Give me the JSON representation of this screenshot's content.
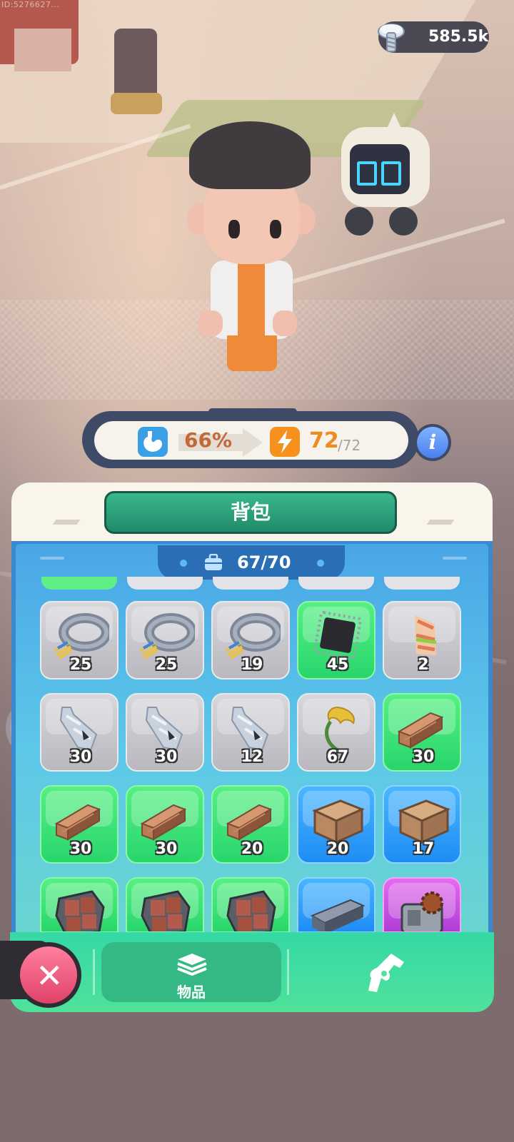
{
  "hud": {
    "currency": {
      "icon": "bolt-icon",
      "value": "585.5k"
    },
    "watermark": "ID:5276627..."
  },
  "stats": {
    "hunger": {
      "icon": "stomach-icon",
      "value": "66%"
    },
    "energy": {
      "icon": "lightning-icon",
      "current": "72",
      "max": "/72"
    },
    "info_label": "i"
  },
  "backpack": {
    "title": "背包",
    "capacity": "67/70",
    "items": [
      {
        "name": "cable",
        "quantity": "25",
        "rarity": "gray"
      },
      {
        "name": "cable",
        "quantity": "25",
        "rarity": "gray"
      },
      {
        "name": "cable",
        "quantity": "19",
        "rarity": "gray"
      },
      {
        "name": "chip",
        "quantity": "45",
        "rarity": "green"
      },
      {
        "name": "cloth-roll",
        "quantity": "2",
        "rarity": "gray"
      },
      {
        "name": "plastic-bottle",
        "quantity": "30",
        "rarity": "gray"
      },
      {
        "name": "plastic-bottle",
        "quantity": "30",
        "rarity": "gray"
      },
      {
        "name": "plastic-bottle",
        "quantity": "12",
        "rarity": "gray"
      },
      {
        "name": "dried-plant",
        "quantity": "67",
        "rarity": "gray"
      },
      {
        "name": "wood-planks",
        "quantity": "30",
        "rarity": "green"
      },
      {
        "name": "wood-planks",
        "quantity": "30",
        "rarity": "green"
      },
      {
        "name": "wood-planks",
        "quantity": "30",
        "rarity": "green"
      },
      {
        "name": "wood-planks",
        "quantity": "20",
        "rarity": "green"
      },
      {
        "name": "wooden-crate",
        "quantity": "20",
        "rarity": "blue"
      },
      {
        "name": "wooden-crate",
        "quantity": "17",
        "rarity": "blue"
      },
      {
        "name": "metal-plate",
        "quantity": "",
        "rarity": "green"
      },
      {
        "name": "metal-plate",
        "quantity": "",
        "rarity": "green"
      },
      {
        "name": "metal-plate",
        "quantity": "",
        "rarity": "green"
      },
      {
        "name": "steel-beam",
        "quantity": "",
        "rarity": "blue"
      },
      {
        "name": "gear-engine",
        "quantity": "",
        "rarity": "purple"
      }
    ]
  },
  "bottom_bar": {
    "items_tab_label": "物品",
    "items_tab_icon": "layers-icon",
    "weapons_tab_icon": "revolver-icon",
    "close_icon": "close-icon"
  },
  "colors": {
    "slot_gray": "#c9c8ce",
    "slot_green": "#3fe479",
    "slot_blue": "#2fa0fa",
    "slot_purple": "#cc52e3",
    "panel_blue": "#3a89cf",
    "title_green": "#2aa37b",
    "energy_orange": "#f08b1f",
    "close_pink": "#e14269"
  }
}
